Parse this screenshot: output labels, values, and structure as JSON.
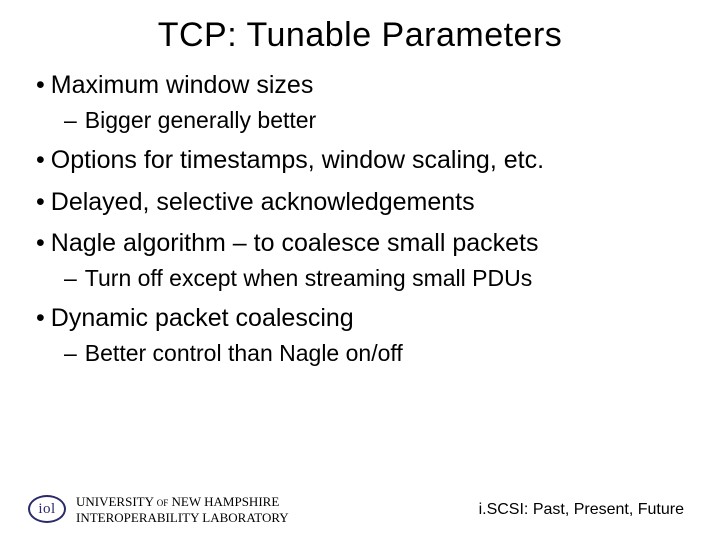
{
  "title": "TCP: Tunable Parameters",
  "bullets": {
    "b1": "Maximum window sizes",
    "b1a": "Bigger generally better",
    "b2": "Options for timestamps, window scaling, etc.",
    "b3": "Delayed, selective acknowledgements",
    "b4": "Nagle algorithm – to coalesce small packets",
    "b4a": "Turn off except when streaming small PDUs",
    "b5": "Dynamic packet coalescing",
    "b5a": "Better control than Nagle on/off"
  },
  "footer": {
    "logo_text": "iol",
    "inst_line1": "UNIVERSITY of NEW HAMPSHIRE",
    "inst_line2": "INTEROPERABILITY LABORATORY",
    "right": "i.SCSI: Past, Present, Future"
  }
}
